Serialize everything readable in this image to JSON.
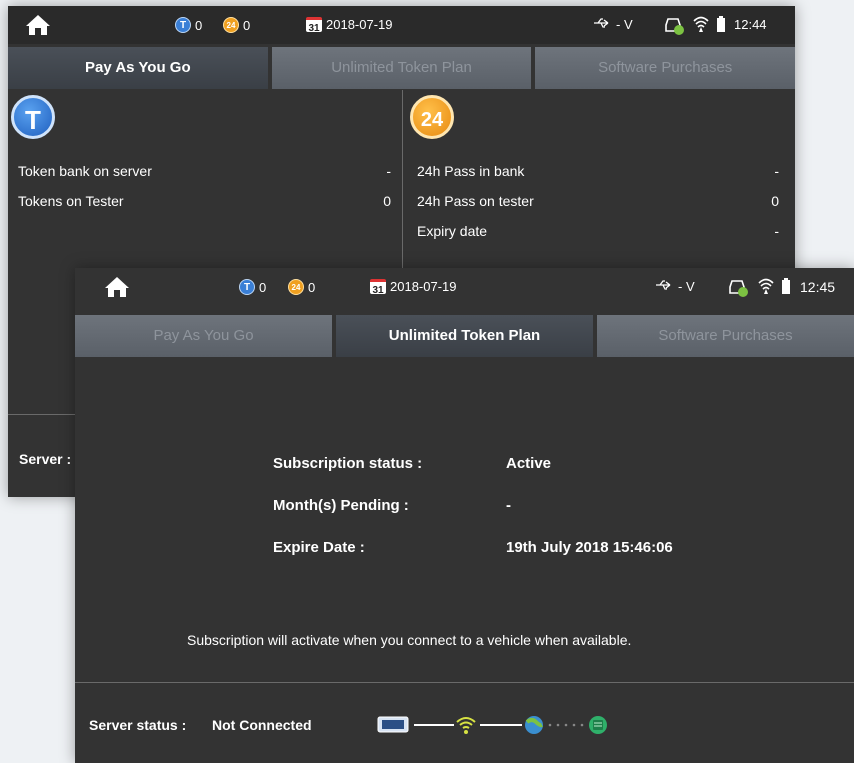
{
  "back_screen": {
    "status_bar": {
      "token_count": "0",
      "pass_count": "0",
      "date": "2018-07-19",
      "calendar_day": "31",
      "voltage": "- V",
      "time": "12:44"
    },
    "tabs": [
      {
        "label": "Pay As You Go",
        "active": true
      },
      {
        "label": "Unlimited Token Plan",
        "active": false
      },
      {
        "label": "Software Purchases",
        "active": false
      }
    ],
    "left_panel": {
      "coin_label": "T",
      "rows": [
        {
          "label": "Token bank on server",
          "value": "-"
        },
        {
          "label": "Tokens on Tester",
          "value": "0"
        }
      ]
    },
    "right_panel": {
      "coin_label": "24",
      "rows": [
        {
          "label": "24h Pass in bank",
          "value": "-"
        },
        {
          "label": "24h Pass on tester",
          "value": "0"
        },
        {
          "label": "Expiry date",
          "value": "-"
        }
      ]
    },
    "server_label": "Server :"
  },
  "front_screen": {
    "status_bar": {
      "token_count": "0",
      "pass_count": "0",
      "date": "2018-07-19",
      "calendar_day": "31",
      "voltage": "- V",
      "time": "12:45"
    },
    "tabs": [
      {
        "label": "Pay As You Go",
        "active": false
      },
      {
        "label": "Unlimited Token Plan",
        "active": true
      },
      {
        "label": "Software Purchases",
        "active": false
      }
    ],
    "subscription": {
      "status_label": "Subscription status :",
      "status_value": "Active",
      "pending_label": "Month(s) Pending :",
      "pending_value": "-",
      "expire_label": "Expire Date :",
      "expire_value": "19th July 2018 15:46:06"
    },
    "message": "Subscription will activate when you connect to a vehicle when available.",
    "server_status": {
      "label": "Server status :",
      "value": "Not Connected"
    }
  },
  "colors": {
    "background": "#333333",
    "token_blue": "#3a7fd6",
    "pass_orange": "#f0a020",
    "battery_green": "#7cc242"
  }
}
